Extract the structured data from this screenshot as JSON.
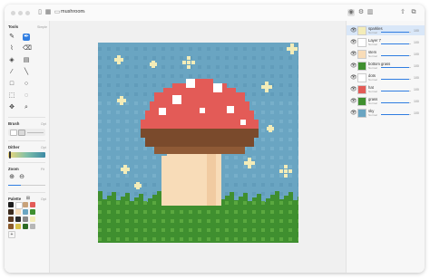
{
  "window": {
    "document_title": "mushroom",
    "colors": {
      "accent": "#2f7de1",
      "sky": "#6aa5c2",
      "grass": "#3f8f2f",
      "cap": "#e35b57",
      "stem": "#f8dcb8",
      "gills": "#7a4a2c",
      "star": "#f3ecb8"
    }
  },
  "toolbar": {
    "icons": [
      "sidebar-icon",
      "grid-icon",
      "document-icon",
      "chevron-down-icon",
      "eye-icon",
      "gear-icon",
      "layers-icon",
      "share-icon",
      "window-icon"
    ]
  },
  "tools_panel": {
    "title": "Tools",
    "title_right": "Simple",
    "tools": [
      {
        "name": "pencil-icon",
        "glyph": "✎",
        "active": false
      },
      {
        "name": "pen-icon",
        "glyph": "✒",
        "active": true
      },
      {
        "name": "brush-icon",
        "glyph": "⌇",
        "active": false
      },
      {
        "name": "eraser-icon",
        "glyph": "⌫",
        "active": false
      },
      {
        "name": "bucket-icon",
        "glyph": "◈",
        "active": false
      },
      {
        "name": "gradient-icon",
        "glyph": "▤",
        "active": false
      },
      {
        "name": "eyedropper-icon",
        "glyph": "⁄",
        "active": false
      },
      {
        "name": "line-icon",
        "glyph": "╲",
        "active": false
      },
      {
        "name": "rectangle-icon",
        "glyph": "□",
        "active": false
      },
      {
        "name": "ellipse-icon",
        "glyph": "○",
        "active": false
      },
      {
        "name": "select-icon",
        "glyph": "⬚",
        "active": false
      },
      {
        "name": "lasso-icon",
        "glyph": "◌",
        "active": false
      },
      {
        "name": "move-icon",
        "glyph": "✥",
        "active": false
      },
      {
        "name": "text-icon",
        "glyph": "⌕",
        "active": false
      }
    ],
    "brush": {
      "title": "Brush",
      "right": "Opt"
    },
    "dither": {
      "title": "Dither",
      "right": "Opt"
    },
    "zoom": {
      "title": "Zoom",
      "right": "Fit"
    },
    "palette": {
      "title": "Palette",
      "right": "Opt"
    },
    "palette_colors": [
      "#1e1e1e",
      "#ffffff",
      "#c8a27a",
      "#e35b57",
      "#3b2a1d",
      "#f8dcb8",
      "#6aa5c2",
      "#3f8f2f",
      "#5a3a22",
      "#2a2a2a",
      "#888888",
      "#f3ecb8",
      "#8a5a2c",
      "#d9c24a",
      "#2d6b25",
      "#b7b7b7"
    ]
  },
  "layers": [
    {
      "name": "sparkles",
      "sub": "Normal",
      "value": "100",
      "selected": true,
      "thumb": "#f3ecb8",
      "fill": 0.95
    },
    {
      "name": "Layer 7",
      "sub": "Normal",
      "value": "100",
      "selected": false,
      "thumb": "#ffffff",
      "fill": 0.95
    },
    {
      "name": "stem",
      "sub": "Normal",
      "value": "100",
      "selected": false,
      "thumb": "#f8dcb8",
      "fill": 0.95
    },
    {
      "name": "bottom grass",
      "sub": "Normal",
      "value": "100",
      "selected": false,
      "thumb": "#3f8f2f",
      "fill": 0.95
    },
    {
      "name": "dots",
      "sub": "Normal",
      "value": "100",
      "selected": false,
      "thumb": "#ffffff",
      "fill": 0.95
    },
    {
      "name": "hat",
      "sub": "Normal",
      "value": "100",
      "selected": false,
      "thumb": "#e35b57",
      "fill": 0.95
    },
    {
      "name": "grass",
      "sub": "Normal",
      "value": "100",
      "selected": false,
      "thumb": "#3f8f2f",
      "fill": 0.95
    },
    {
      "name": "sky",
      "sub": "Normal",
      "value": "100",
      "selected": false,
      "thumb": "#6aa5c2",
      "fill": 0.95
    }
  ]
}
